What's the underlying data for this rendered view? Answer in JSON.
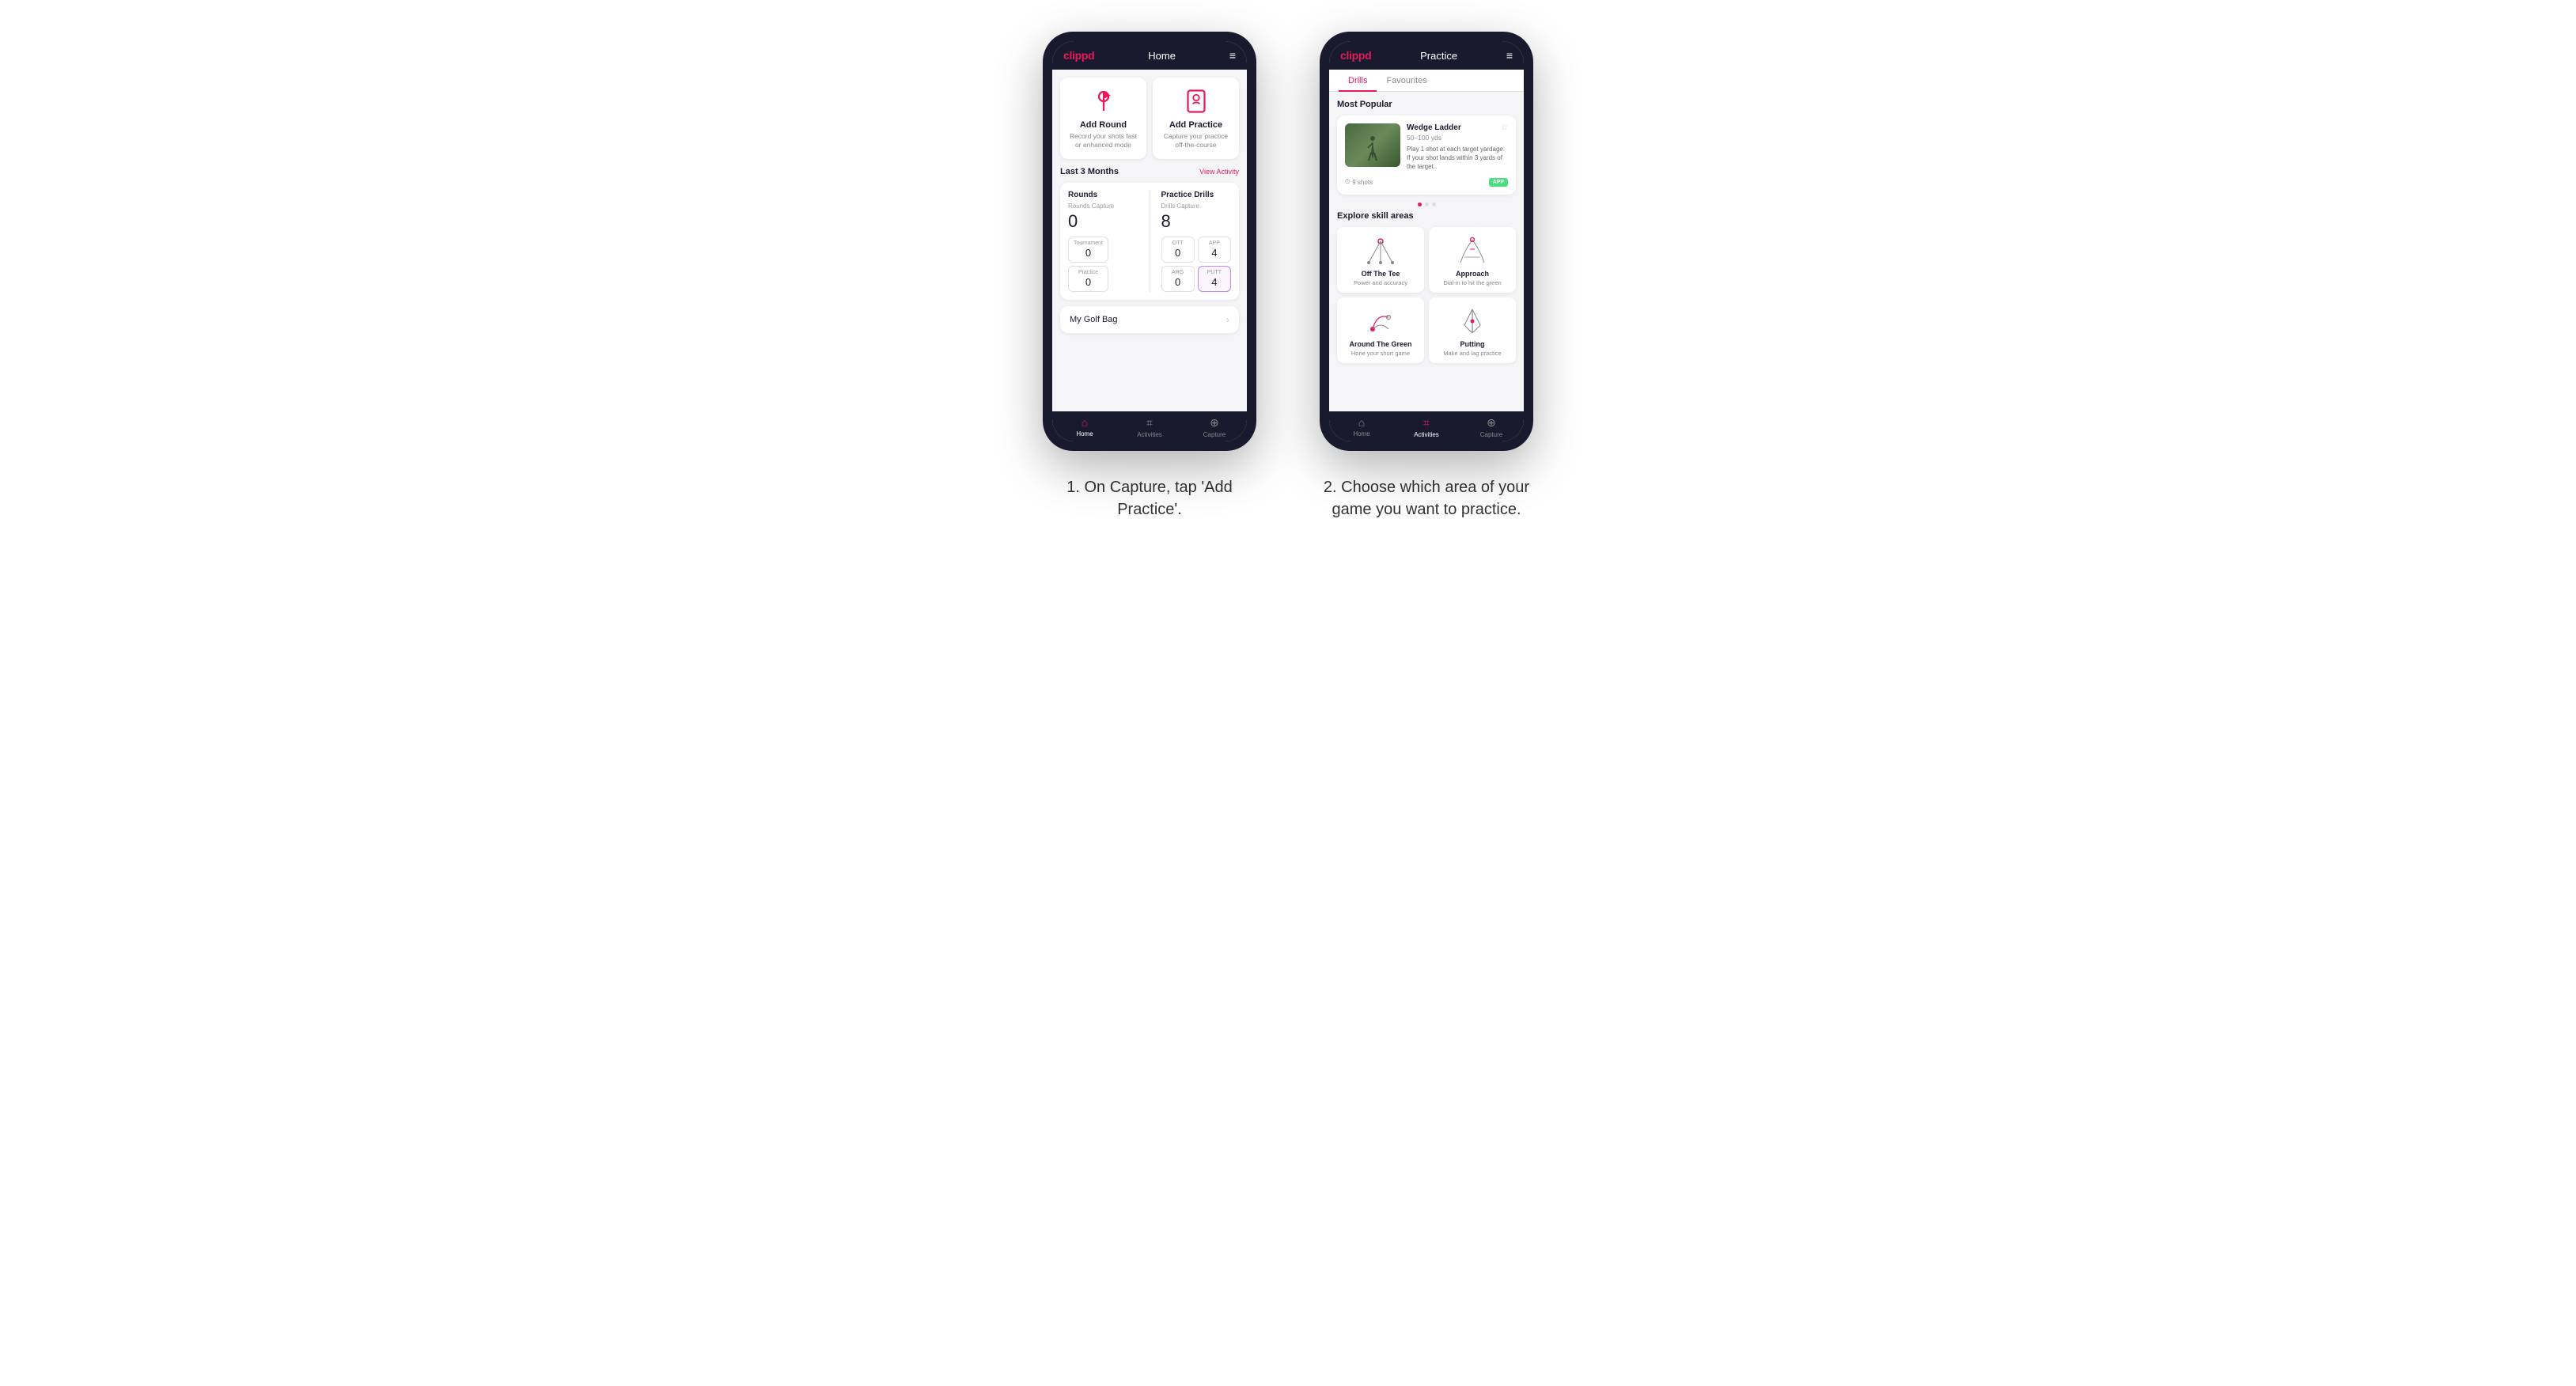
{
  "phone1": {
    "header": {
      "logo": "clippd",
      "title": "Home",
      "menu_icon": "≡"
    },
    "add_round": {
      "title": "Add Round",
      "desc": "Record your shots fast or enhanced mode",
      "icon": "flag"
    },
    "add_practice": {
      "title": "Add Practice",
      "desc": "Capture your practice off-the-course",
      "icon": "calendar"
    },
    "last_section": {
      "label": "Last 3 Months",
      "view_link": "View Activity"
    },
    "rounds": {
      "heading": "Rounds",
      "rounds_capture_label": "Rounds Capture",
      "rounds_capture_value": "0",
      "tournament_label": "Tournament",
      "tournament_value": "0",
      "ott_label": "OTT",
      "ott_value": "0",
      "app_label": "APP",
      "app_value": "4",
      "practice_label": "Practice",
      "practice_value": "0",
      "arg_label": "ARG",
      "arg_value": "0",
      "putt_label": "PUTT",
      "putt_value": "4"
    },
    "practice_drills": {
      "heading": "Practice Drills",
      "drills_capture_label": "Drills Capture",
      "drills_capture_value": "8"
    },
    "my_golf_bag": {
      "label": "My Golf Bag"
    },
    "nav": {
      "home_label": "Home",
      "activities_label": "Activities",
      "capture_label": "Capture"
    }
  },
  "phone2": {
    "header": {
      "logo": "clippd",
      "title": "Practice",
      "menu_icon": "≡"
    },
    "tabs": [
      {
        "label": "Drills",
        "active": true
      },
      {
        "label": "Favourites",
        "active": false
      }
    ],
    "most_popular_heading": "Most Popular",
    "featured_drill": {
      "title": "Wedge Ladder",
      "yardage": "50–100 yds",
      "description": "Play 1 shot at each target yardage. If your shot lands within 3 yards of the target..",
      "shots": "9 shots",
      "badge": "APP"
    },
    "explore_heading": "Explore skill areas",
    "skill_areas": [
      {
        "name": "Off The Tee",
        "desc": "Power and accuracy",
        "icon": "tee-diagram"
      },
      {
        "name": "Approach",
        "desc": "Dial-in to hit the green",
        "icon": "approach-diagram"
      },
      {
        "name": "Around The Green",
        "desc": "Hone your short game",
        "icon": "atg-diagram"
      },
      {
        "name": "Putting",
        "desc": "Make and lag practice",
        "icon": "putting-diagram"
      }
    ],
    "nav": {
      "home_label": "Home",
      "activities_label": "Activities",
      "capture_label": "Capture"
    }
  },
  "captions": {
    "caption1": "1. On Capture, tap 'Add Practice'.",
    "caption2": "2. Choose which area of your game you want to practice."
  }
}
